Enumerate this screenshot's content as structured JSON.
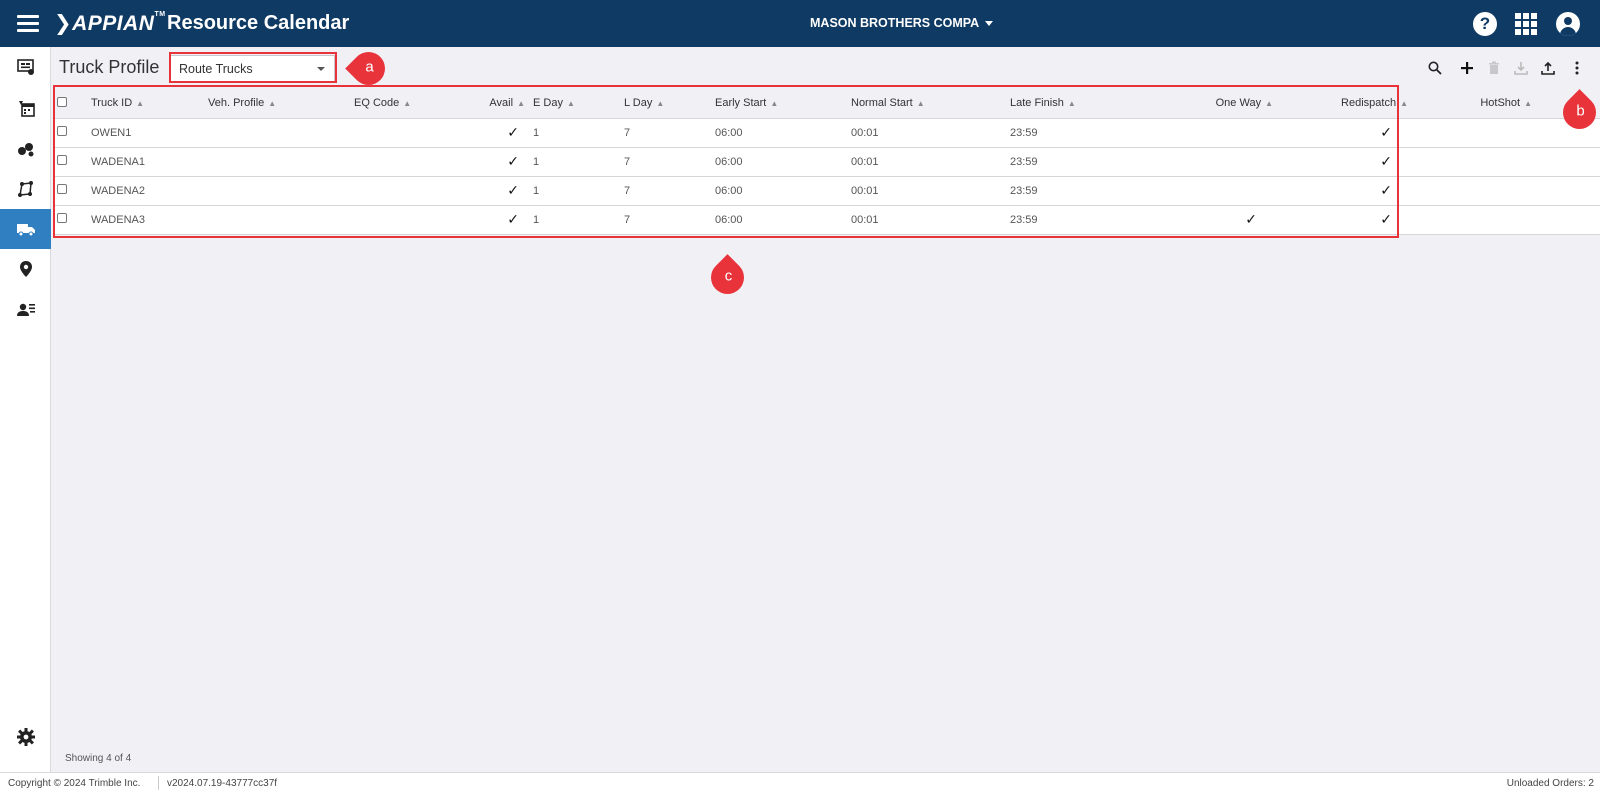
{
  "topbar": {
    "logo": "APPIAN",
    "logo_tm": "TM",
    "title": "Resource Calendar",
    "company": "MASON BROTHERS COMPA",
    "help_label": "?"
  },
  "page": {
    "title": "Truck Profile",
    "select_value": "Route Trucks"
  },
  "annotations": [
    "a",
    "b",
    "c"
  ],
  "table": {
    "columns": [
      "Truck ID",
      "Veh. Profile",
      "EQ Code",
      "Avail",
      "E Day",
      "L Day",
      "Early Start",
      "Normal Start",
      "Late Finish",
      "One Way",
      "Redispatch",
      "HotShot"
    ],
    "rows": [
      {
        "truck_id": "OWEN1",
        "veh_profile": "",
        "eq_code": "",
        "avail": true,
        "e_day": "1",
        "l_day": "7",
        "early_start": "06:00",
        "normal_start": "00:01",
        "late_finish": "23:59",
        "one_way": false,
        "redispatch": true,
        "hotshot": false
      },
      {
        "truck_id": "WADENA1",
        "veh_profile": "",
        "eq_code": "",
        "avail": true,
        "e_day": "1",
        "l_day": "7",
        "early_start": "06:00",
        "normal_start": "00:01",
        "late_finish": "23:59",
        "one_way": false,
        "redispatch": true,
        "hotshot": false
      },
      {
        "truck_id": "WADENA2",
        "veh_profile": "",
        "eq_code": "",
        "avail": true,
        "e_day": "1",
        "l_day": "7",
        "early_start": "06:00",
        "normal_start": "00:01",
        "late_finish": "23:59",
        "one_way": false,
        "redispatch": true,
        "hotshot": false
      },
      {
        "truck_id": "WADENA3",
        "veh_profile": "",
        "eq_code": "",
        "avail": true,
        "e_day": "1",
        "l_day": "7",
        "early_start": "06:00",
        "normal_start": "00:01",
        "late_finish": "23:59",
        "one_way": true,
        "redispatch": true,
        "hotshot": false
      }
    ]
  },
  "status": {
    "showing": "Showing 4 of 4"
  },
  "footer": {
    "copyright": "Copyright © 2024 Trimble Inc.",
    "version": "v2024.07.19-43777cc37f",
    "unloaded": "Unloaded Orders: 2"
  },
  "icons": {
    "sidebar": [
      "dashboard-icon",
      "calendar-icon",
      "resources-icon",
      "routes-icon",
      "truck-icon",
      "location-icon",
      "drivers-icon",
      "settings-icon"
    ],
    "toolbar": [
      "search-icon",
      "add-icon",
      "delete-icon",
      "download-icon",
      "upload-icon",
      "more-options-icon"
    ]
  },
  "colors": {
    "topbar": "#0f3a63",
    "active_sidebar": "#2f7fc1",
    "annotation": "#e8333a"
  }
}
